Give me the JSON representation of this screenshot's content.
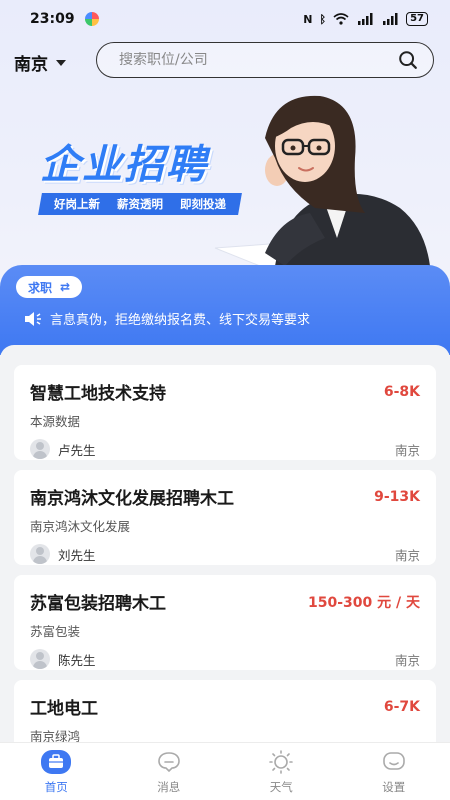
{
  "status_bar": {
    "time": "23:09",
    "indicators": [
      "nfc-icon",
      "bluetooth-icon",
      "wifi-icon",
      "signal-4g-icon",
      "signal-4g-icon"
    ],
    "battery": "57"
  },
  "header": {
    "city": "南京",
    "search_placeholder": "搜索职位/公司"
  },
  "hero": {
    "title": "企业招聘",
    "taglines": [
      "好岗上新",
      "薪资透明",
      "即刻投递"
    ]
  },
  "notice": {
    "mode_label": "求职",
    "text": "言息真伪，拒绝缴纳报名费、线下交易等要求"
  },
  "jobs": [
    {
      "title": "智慧工地技术支持",
      "salary": "6-8K",
      "company": "本源数据",
      "recruiter": "卢先生",
      "city": "南京"
    },
    {
      "title": "南京鸿沐文化发展招聘木工",
      "salary": "9-13K",
      "company": "南京鸿沐文化发展",
      "recruiter": "刘先生",
      "city": "南京"
    },
    {
      "title": "苏富包装招聘木工",
      "salary": "150-300 元 / 天",
      "company": "苏富包装",
      "recruiter": "陈先生",
      "city": "南京"
    },
    {
      "title": "工地电工",
      "salary": "6-7K",
      "company": "南京绿鸿",
      "recruiter": "",
      "city": ""
    }
  ],
  "tabs": [
    {
      "label": "首页",
      "icon": "briefcase-icon",
      "active": true
    },
    {
      "label": "消息",
      "icon": "chat-bubble-icon",
      "active": false
    },
    {
      "label": "天气",
      "icon": "sun-icon",
      "active": false
    },
    {
      "label": "设置",
      "icon": "settings-face-icon",
      "active": false
    }
  ],
  "colors": {
    "accent": "#3e78f2",
    "salary": "#e0483e",
    "hero_title": "#2f7df6"
  }
}
